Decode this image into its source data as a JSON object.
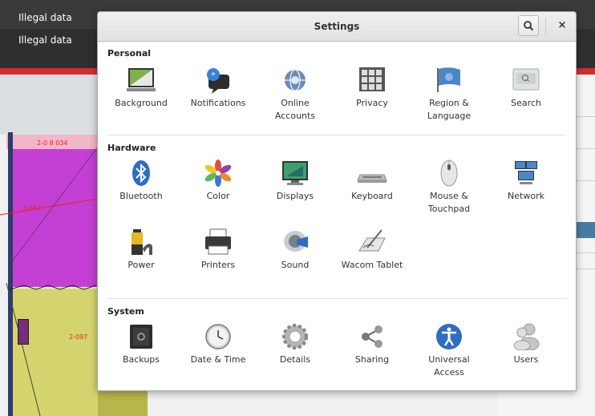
{
  "background": {
    "tabs": [
      "Illegal data",
      "Illegal data"
    ],
    "map_labels": [
      "2-0 8 034",
      "2-047",
      "2-097"
    ]
  },
  "dialog": {
    "title": "Settings",
    "sections": [
      {
        "title": "Personal",
        "items": [
          {
            "label": "Background",
            "icon": "background-icon"
          },
          {
            "label": "Notifications",
            "icon": "notifications-icon"
          },
          {
            "label": "Online\nAccounts",
            "icon": "online-accounts-icon"
          },
          {
            "label": "Privacy",
            "icon": "privacy-icon"
          },
          {
            "label": "Region &\nLanguage",
            "icon": "region-language-icon"
          },
          {
            "label": "Search",
            "icon": "search-panel-icon"
          }
        ]
      },
      {
        "title": "Hardware",
        "items": [
          {
            "label": "Bluetooth",
            "icon": "bluetooth-icon"
          },
          {
            "label": "Color",
            "icon": "color-icon"
          },
          {
            "label": "Displays",
            "icon": "displays-icon"
          },
          {
            "label": "Keyboard",
            "icon": "keyboard-icon"
          },
          {
            "label": "Mouse &\nTouchpad",
            "icon": "mouse-icon"
          },
          {
            "label": "Network",
            "icon": "network-icon"
          },
          {
            "label": "Power",
            "icon": "power-icon"
          },
          {
            "label": "Printers",
            "icon": "printers-icon"
          },
          {
            "label": "Sound",
            "icon": "sound-icon"
          },
          {
            "label": "Wacom Tablet",
            "icon": "wacom-tablet-icon"
          }
        ]
      },
      {
        "title": "System",
        "items": [
          {
            "label": "Backups",
            "icon": "backups-icon"
          },
          {
            "label": "Date & Time",
            "icon": "date-time-icon"
          },
          {
            "label": "Details",
            "icon": "details-icon"
          },
          {
            "label": "Sharing",
            "icon": "sharing-icon"
          },
          {
            "label": "Universal\nAccess",
            "icon": "universal-access-icon"
          },
          {
            "label": "Users",
            "icon": "users-icon"
          }
        ]
      }
    ]
  }
}
